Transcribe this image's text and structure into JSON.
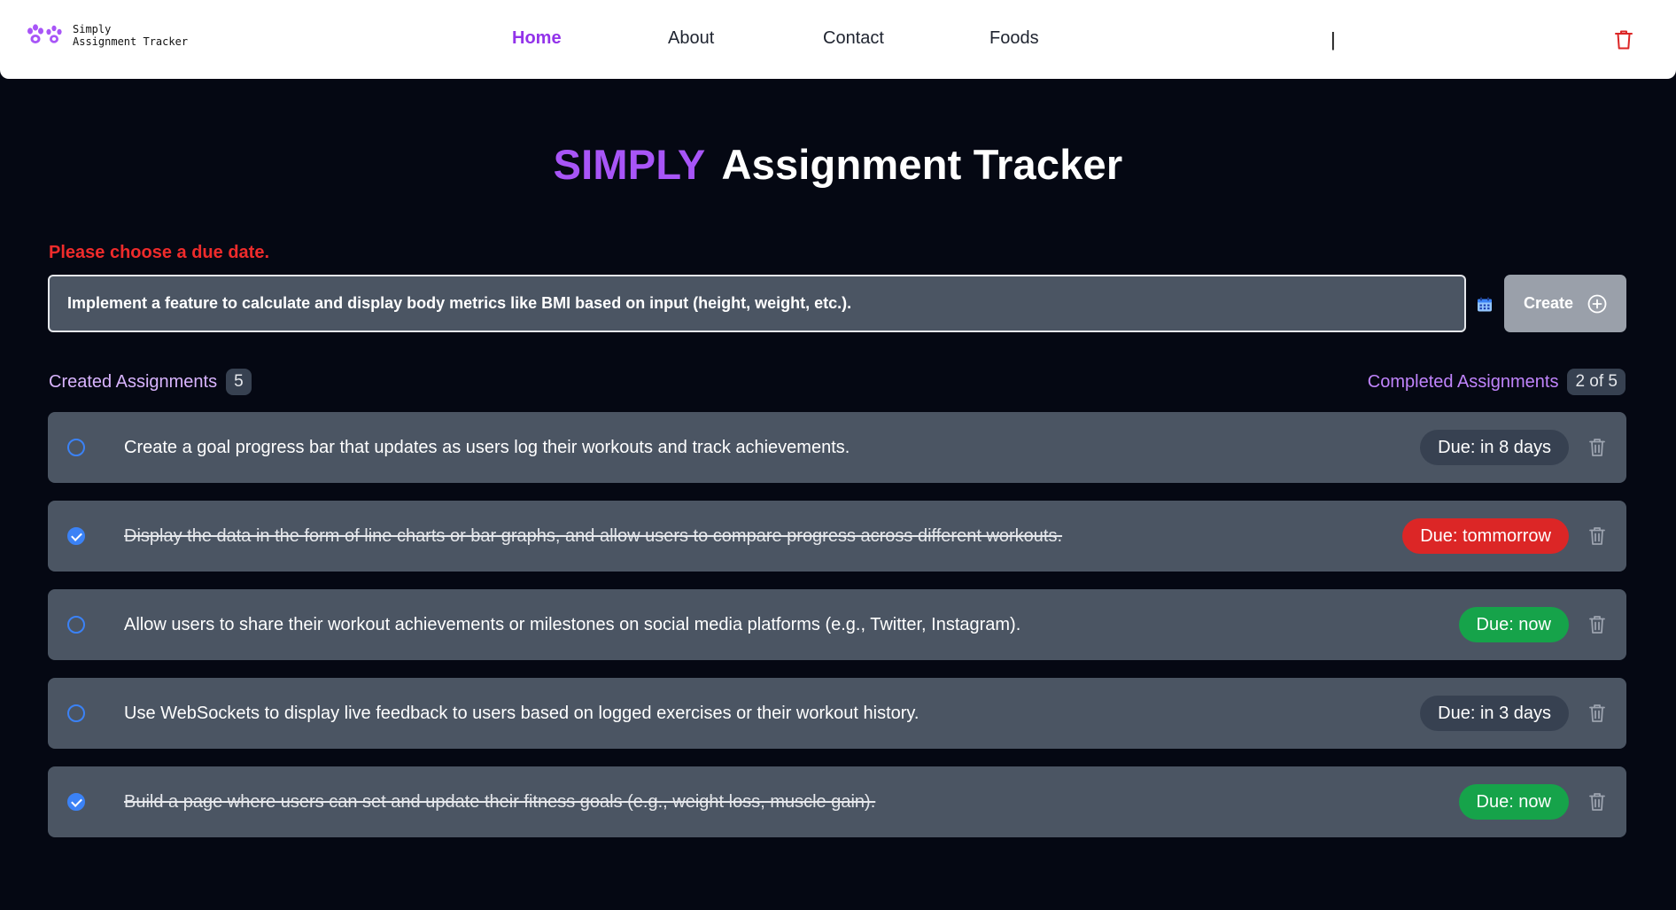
{
  "nav": {
    "logo_line1": "Simply",
    "logo_line2": "Assignment Tracker",
    "links": [
      "Home",
      "About",
      "Contact",
      "Foods"
    ],
    "active_link": "Home",
    "separator": "|"
  },
  "hero": {
    "accent": "SIMPLY",
    "title": "Assignment Tracker"
  },
  "form": {
    "error": "Please choose a due date.",
    "input_value": "Implement a feature to calculate and display body metrics like BMI based on input (height, weight, etc.).",
    "create_label": "Create"
  },
  "counters": {
    "created_label": "Created Assignments",
    "created_count": "5",
    "completed_label": "Completed Assignments",
    "completed_count": "2 of 5"
  },
  "tasks": [
    {
      "text": "Create a goal progress bar that updates as users log their workouts and track achievements.",
      "done": false,
      "due": "Due: in 8 days",
      "due_color": "#374151"
    },
    {
      "text": "Display the data in the form of line charts or bar graphs, and allow users to compare progress across different workouts.",
      "done": true,
      "due": "Due: tommorrow",
      "due_color": "#dc2626"
    },
    {
      "text": "Allow users to share their workout achievements or milestones on social media platforms (e.g., Twitter, Instagram).",
      "done": false,
      "due": "Due: now",
      "due_color": "#16a34a"
    },
    {
      "text": "Use WebSockets to display live feedback to users based on logged exercises or their workout history.",
      "done": false,
      "due": "Due: in 3 days",
      "due_color": "#374151"
    },
    {
      "text": "Build a page where users can set and update their fitness goals (e.g., weight loss, muscle gain).",
      "done": true,
      "due": "Due: now",
      "due_color": "#16a34a"
    }
  ],
  "colors": {
    "accent": "#a855f7",
    "background": "#050813",
    "card": "#4b5563",
    "error": "#ef2b2b",
    "check": "#3b82f6"
  },
  "icons": [
    "paw-icon",
    "trash-icon",
    "calendar-icon",
    "plus-circle-icon",
    "check-circle-icon"
  ]
}
